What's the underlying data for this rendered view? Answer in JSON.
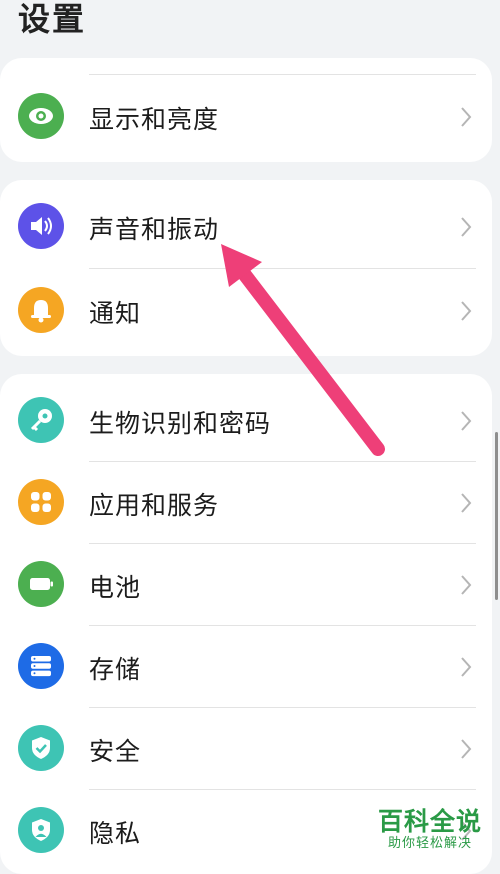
{
  "page": {
    "title": "设置"
  },
  "groups": [
    {
      "items": [
        {
          "label": "显示和亮度",
          "icon": "eye-icon",
          "color": "#4caf50"
        }
      ]
    },
    {
      "items": [
        {
          "label": "声音和振动",
          "icon": "volume-icon",
          "color": "#5d52e8"
        },
        {
          "label": "通知",
          "icon": "bell-icon",
          "color": "#f5a623"
        }
      ]
    },
    {
      "items": [
        {
          "label": "生物识别和密码",
          "icon": "key-icon",
          "color": "#3ec4b4"
        },
        {
          "label": "应用和服务",
          "icon": "apps-grid-icon",
          "color": "#f5a623"
        },
        {
          "label": "电池",
          "icon": "battery-icon",
          "color": "#4caf50"
        },
        {
          "label": "存储",
          "icon": "storage-icon",
          "color": "#1e6be6"
        },
        {
          "label": "安全",
          "icon": "shield-check-icon",
          "color": "#3ec4b4"
        },
        {
          "label": "隐私",
          "icon": "privacy-icon",
          "color": "#3ec4b4"
        }
      ]
    }
  ],
  "annotation": {
    "color": "#ee3f78"
  },
  "watermark": {
    "title": "百科全说",
    "subtitle": "助你轻松解决",
    "color": "#2a9a46"
  }
}
